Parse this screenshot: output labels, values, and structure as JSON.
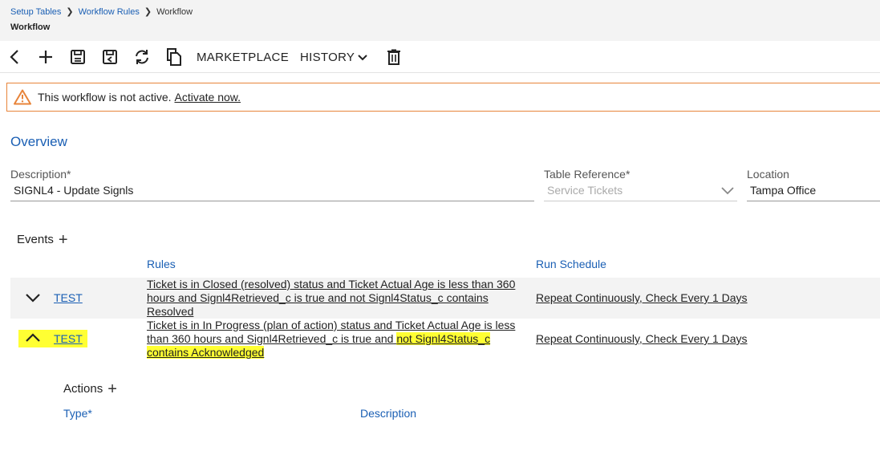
{
  "breadcrumb": {
    "items": [
      "Setup Tables",
      "Workflow Rules"
    ],
    "current": "Workflow"
  },
  "page_title": "Workflow",
  "toolbar": {
    "back_icon": "chevron-left-icon",
    "add_icon": "plus-icon",
    "save_icon": "save-icon",
    "save_close_icon": "save-close-icon",
    "refresh_icon": "refresh-icon",
    "copy_icon": "copy-icon",
    "marketplace_label": "MARKETPLACE",
    "history_label": "HISTORY",
    "delete_icon": "trash-icon"
  },
  "alert": {
    "message": "This workflow is not active.",
    "link": "Activate now."
  },
  "overview": {
    "title": "Overview",
    "description_label": "Description*",
    "description_value": "SIGNL4 - Update Signls",
    "table_ref_label": "Table Reference*",
    "table_ref_value": "Service Tickets",
    "location_label": "Location",
    "location_value": "Tampa Office"
  },
  "events": {
    "label": "Events",
    "col_rules": "Rules",
    "col_schedule": "Run Schedule",
    "rows": [
      {
        "name": "TEST",
        "rule": "Ticket is in Closed (resolved) status and Ticket Actual Age is less than 360 hours and Signl4Retrieved_c is true and not Signl4Status_c contains Resolved",
        "schedule": "Repeat Continuously, Check Every 1 Days",
        "expanded": false
      },
      {
        "name": "TEST",
        "rule_part1": "Ticket is in In Progress (plan of action) status and Ticket Actual Age is less than 360 hours and Signl4Retrieved_c is true and",
        "rule_part2": "not Signl4Status_c contains Acknowledged",
        "schedule": "Repeat Continuously, Check Every 1 Days",
        "expanded": true
      }
    ]
  },
  "actions": {
    "label": "Actions",
    "col_type": "Type*",
    "col_description": "Description"
  },
  "colors": {
    "accent": "#1a5fb4",
    "warning": "#e8843a",
    "highlight": "#ffff33"
  }
}
